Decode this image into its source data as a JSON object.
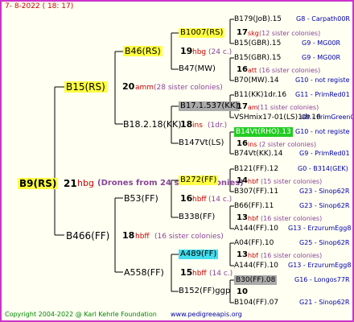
{
  "header": {
    "date": "7- 8-2022 ( 18: 17)"
  },
  "footer": {
    "copyright": "Copyright 2004-2022 @ Karl Kehrle Foundation",
    "url": "www.pedigreeapis.org"
  },
  "root": {
    "name": "B9(RS)",
    "number": "21",
    "breeder": "hbg",
    "note": "(Drones from 24 sister colonies)"
  },
  "gen1": {
    "top": {
      "name": "B15(RS)",
      "number": "20",
      "breeder": "amm",
      "note": "(28 sister colonies)"
    },
    "bottom": {
      "name": "B466(FF)",
      "number": "18",
      "breeder": "hbff",
      "note": "(16 sister colonies)"
    }
  },
  "gen2": [
    {
      "name": "B46(RS)",
      "number": "19",
      "breeder": "hbg",
      "note": "(24 c.)"
    },
    {
      "name": "B18.2.18(KK)",
      "number": "18",
      "breeder": "ins",
      "note": "(1dr.)"
    },
    {
      "name": "B53(FF)",
      "number": "16",
      "breeder": "hbff",
      "note": "(14 c.)"
    },
    {
      "name": "A558(FF)",
      "number": "15",
      "breeder": "hbff",
      "note": "(14 c.)"
    }
  ],
  "gen3": [
    {
      "name": "B1007(RS)",
      "number": "17",
      "breeder": "skg",
      "note": "(12 sister colonies)"
    },
    {
      "name": "B47(MW)",
      "number": "16",
      "breeder": "att",
      "note": "(16 sister colonies)"
    },
    {
      "name": "B17.1.537(KK)",
      "number": "17",
      "breeder": "am",
      "note": "(11 sister colonies)"
    },
    {
      "name": "B147Vt(LS)",
      "number": "16",
      "breeder": "ins",
      "note": "(2 sister colonies)"
    },
    {
      "name": "B272(FF)",
      "number": "14",
      "breeder": "hbf",
      "note": "(15 sister colonies)"
    },
    {
      "name": "B338(FF)",
      "number": "13",
      "breeder": "hbf",
      "note": "(16 sister colonies)"
    },
    {
      "name": "A489(FF)",
      "number": "13",
      "breeder": "hbf",
      "note": "(16 sister colonies)"
    },
    {
      "name": "B152(FF)ggp",
      "number": "10",
      "breeder": "",
      "note": ""
    }
  ],
  "gen4": [
    {
      "name": "B179(JoB).15",
      "info": "G8 - Carpath00R"
    },
    {
      "name": "B15(GBR).15",
      "info": "G9 - MG00R"
    },
    {
      "name": "B15(GBR).15",
      "info": "G9 - MG00R"
    },
    {
      "name": "B70(MW).14",
      "info": "G10 - not registe"
    },
    {
      "name": "B11(KK)1dr.16",
      "info": "G11 - PrimRed01"
    },
    {
      "name": "VSHmix17-01(LS)1dr.16",
      "info": "G9 - PrimGreen00"
    },
    {
      "name": "B14Vt(RHO).13",
      "info": "G10 - not registe"
    },
    {
      "name": "B74Vt(KK).14",
      "info": "G9 - PrimRed01"
    },
    {
      "name": "B121(FF).12",
      "info": "G0 - B314(GEK)"
    },
    {
      "name": "B307(FF).11",
      "info": "G23 - Sinop62R"
    },
    {
      "name": "B66(FF).11",
      "info": "G23 - Sinop62R"
    },
    {
      "name": "A144(FF).10",
      "info": "G13 - ErzurumEgg8"
    },
    {
      "name": "A04(FF).10",
      "info": "G25 - Sinop62R"
    },
    {
      "name": "A144(FF).10",
      "info": "G13 - ErzurumEgg8"
    },
    {
      "name": "B30(FF).08",
      "info": "G16 - Longos77R"
    },
    {
      "name": "B104(FF).07",
      "info": "G21 - Sinop62R"
    }
  ],
  "colors": {
    "frame": "#cc33cc",
    "background": "#fffff2",
    "highlight_yellow": "#ffff44",
    "highlight_cyan": "#44ddee",
    "highlight_grey": "#aaaaaa",
    "highlight_green": "#22cc22",
    "breeder_red": "#cc0000",
    "note_purple": "#884499",
    "info_blue": "#0000aa",
    "footer_green": "#008800"
  }
}
